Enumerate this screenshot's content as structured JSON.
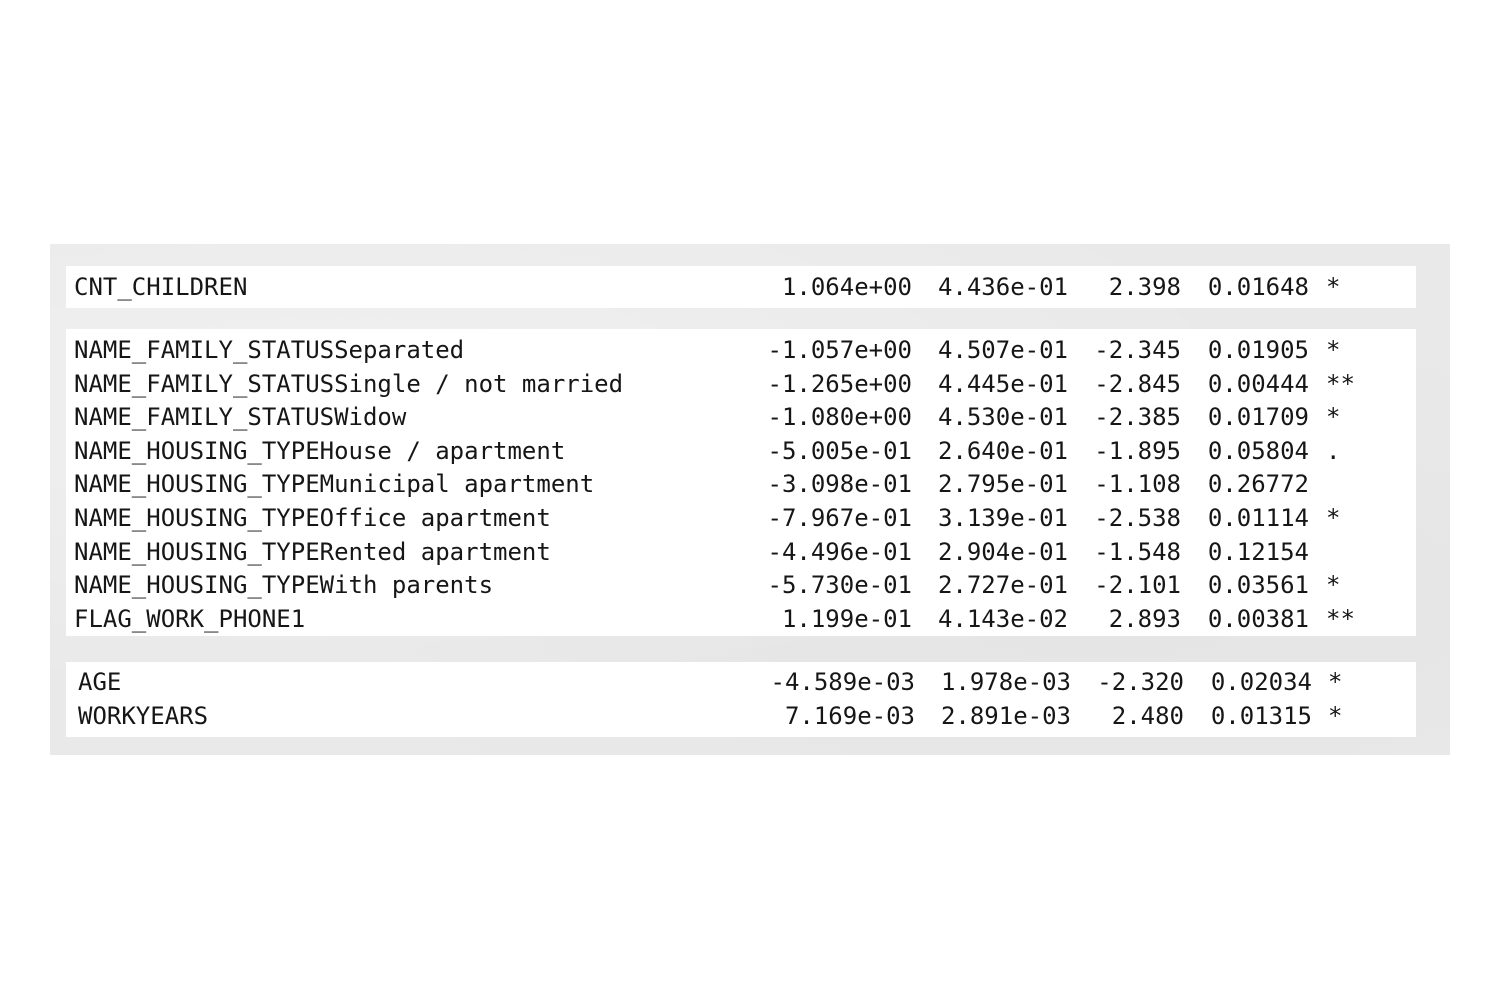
{
  "groups": [
    {
      "rows": [
        {
          "term": "CNT_CHILDREN",
          "estimate": "1.064e+00",
          "std_error": "4.436e-01",
          "z_value": "2.398",
          "p_value": "0.01648",
          "signif": "*"
        }
      ]
    },
    {
      "rows": [
        {
          "term": "NAME_FAMILY_STATUSSeparated",
          "estimate": "-1.057e+00",
          "std_error": "4.507e-01",
          "z_value": "-2.345",
          "p_value": "0.01905",
          "signif": "*"
        },
        {
          "term": "NAME_FAMILY_STATUSSingle / not married",
          "estimate": "-1.265e+00",
          "std_error": "4.445e-01",
          "z_value": "-2.845",
          "p_value": "0.00444",
          "signif": "**"
        },
        {
          "term": "NAME_FAMILY_STATUSWidow",
          "estimate": "-1.080e+00",
          "std_error": "4.530e-01",
          "z_value": "-2.385",
          "p_value": "0.01709",
          "signif": "*"
        },
        {
          "term": "NAME_HOUSING_TYPEHouse / apartment",
          "estimate": "-5.005e-01",
          "std_error": "2.640e-01",
          "z_value": "-1.895",
          "p_value": "0.05804",
          "signif": "."
        },
        {
          "term": "NAME_HOUSING_TYPEMunicipal apartment",
          "estimate": "-3.098e-01",
          "std_error": "2.795e-01",
          "z_value": "-1.108",
          "p_value": "0.26772",
          "signif": ""
        },
        {
          "term": "NAME_HOUSING_TYPEOffice apartment",
          "estimate": "-7.967e-01",
          "std_error": "3.139e-01",
          "z_value": "-2.538",
          "p_value": "0.01114",
          "signif": "*"
        },
        {
          "term": "NAME_HOUSING_TYPERented apartment",
          "estimate": "-4.496e-01",
          "std_error": "2.904e-01",
          "z_value": "-1.548",
          "p_value": "0.12154",
          "signif": ""
        },
        {
          "term": "NAME_HOUSING_TYPEWith parents",
          "estimate": "-5.730e-01",
          "std_error": "2.727e-01",
          "z_value": "-2.101",
          "p_value": "0.03561",
          "signif": "*"
        },
        {
          "term": "FLAG_WORK_PHONE1",
          "estimate": "1.199e-01",
          "std_error": "4.143e-02",
          "z_value": "2.893",
          "p_value": "0.00381",
          "signif": "**"
        }
      ]
    },
    {
      "rows": [
        {
          "term": "AGE",
          "estimate": "-4.589e-03",
          "std_error": "1.978e-03",
          "z_value": "-2.320",
          "p_value": "0.02034",
          "signif": "*"
        },
        {
          "term": "WORKYEARS",
          "estimate": "7.169e-03",
          "std_error": "2.891e-03",
          "z_value": "2.480",
          "p_value": "0.01315",
          "signif": "*"
        }
      ]
    }
  ]
}
